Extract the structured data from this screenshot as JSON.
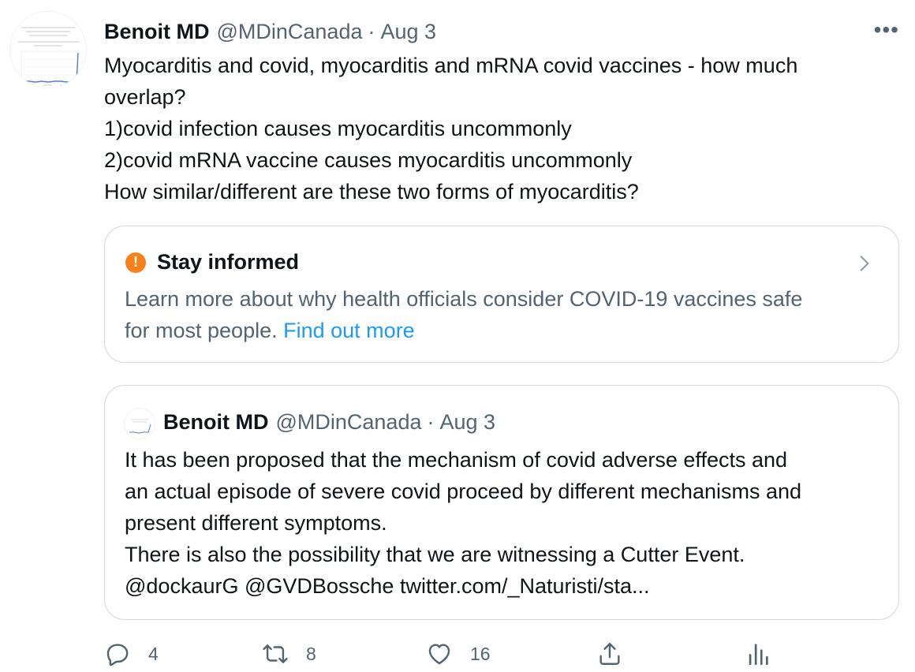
{
  "tweet": {
    "author_name": "Benoit MD",
    "author_handle": "@MDinCanada",
    "separator": "·",
    "date": "Aug 3",
    "more": "•••",
    "text_lines": [
      "Myocarditis and covid, myocarditis and mRNA covid vaccines - how much",
      "overlap?",
      "1)covid infection causes myocarditis uncommonly",
      "2)covid mRNA vaccine causes myocarditis uncommonly",
      "How similar/different are these two forms of myocarditis?"
    ]
  },
  "notice": {
    "icon": "warning-icon",
    "title": "Stay informed",
    "body_line1": "Learn more about why health officials consider COVID-19 vaccines safe",
    "body_line2": "for most people.",
    "link": "Find out more",
    "accent_color": "#f7821b",
    "link_color": "#1d9bf0"
  },
  "quoted_tweet": {
    "author_name": "Benoit MD",
    "author_handle": "@MDinCanada",
    "separator": "·",
    "date": "Aug 3",
    "text_lines": [
      "It has been proposed that the mechanism of covid adverse effects and",
      "an actual episode of severe covid proceed by different mechanisms and",
      "present different symptoms.",
      "There is also the possibility that we are witnessing a Cutter Event.",
      "@dockaurG @GVDBossche twitter.com/_Naturisti/sta..."
    ]
  },
  "actions": {
    "reply_count": "4",
    "retweet_count": "8",
    "like_count": "16",
    "icons": [
      "reply-icon",
      "retweet-icon",
      "like-icon",
      "share-icon",
      "analytics-icon"
    ]
  }
}
